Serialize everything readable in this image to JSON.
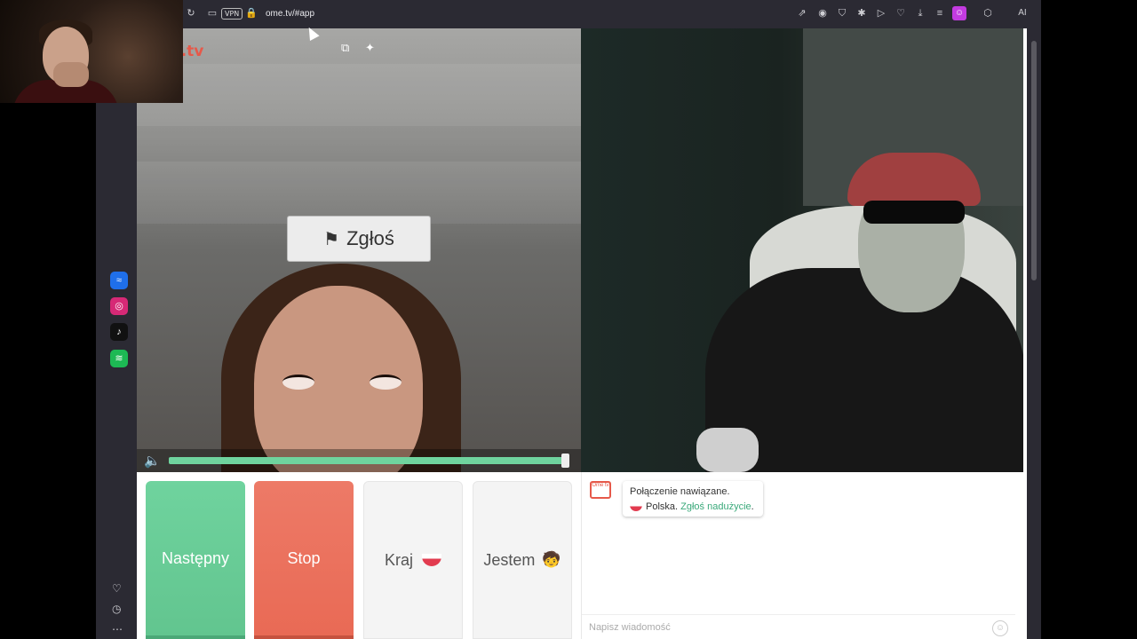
{
  "browser": {
    "url": "ome.tv/#app",
    "vpn_label": "VPN",
    "ai_label": "AI",
    "toolbar_icons": [
      "reload-icon",
      "tab-icon",
      "lock-icon",
      "share-icon",
      "camera-icon",
      "shield-icon",
      "extension-icon",
      "play-icon",
      "heart-icon",
      "download-icon",
      "menu-icon",
      "profile-icon",
      "cube-icon"
    ]
  },
  "sidebar": {
    "apps": [
      {
        "name": "messenger",
        "glyph": "≈",
        "color": "#1f6fea"
      },
      {
        "name": "instagram",
        "glyph": "◎",
        "color": "#d62976"
      },
      {
        "name": "tiktok",
        "glyph": "♪",
        "color": "#111111"
      },
      {
        "name": "spotify",
        "glyph": "≋",
        "color": "#1db954"
      }
    ],
    "bottom": [
      "heart-icon",
      "clock-icon",
      "more-icon"
    ]
  },
  "video": {
    "logo": "Ome.tv",
    "report_label": "Zgłoś",
    "volume_fraction": 0.98
  },
  "controls": {
    "next_label": "Następny",
    "stop_label": "Stop",
    "country_label": "Kraj",
    "gender_label": "Jestem",
    "gender_emoji": "🧒"
  },
  "chat": {
    "tv_icon_text": "Ome tv",
    "connection_text": "Połączenie nawiązane.",
    "country_text": "Polska.",
    "report_link": "Zgłoś nadużycie",
    "report_link_suffix": ".",
    "input_placeholder": "Napisz wiadomość"
  },
  "colors": {
    "next": "#6fd39e",
    "stop": "#ed7a67",
    "brand": "#e6594a",
    "link": "#3aa97a"
  }
}
